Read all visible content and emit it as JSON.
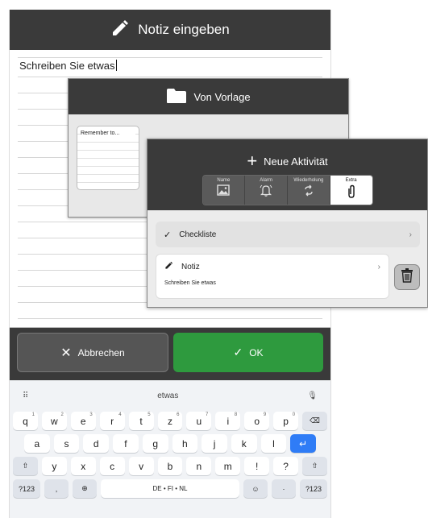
{
  "note_screen": {
    "title": "Notiz eingeben",
    "text": "Schreiben Sie etwas",
    "cancel_label": "Abbrechen",
    "ok_label": "OK",
    "colors": {
      "header": "#3a3a3a",
      "ok": "#2e9a3e",
      "cancel": "#555555"
    }
  },
  "keyboard": {
    "suggestion": "etwas",
    "rows": [
      [
        {
          "k": "q",
          "s": "1"
        },
        {
          "k": "w",
          "s": "2"
        },
        {
          "k": "e",
          "s": "3"
        },
        {
          "k": "r",
          "s": "4"
        },
        {
          "k": "t",
          "s": "5"
        },
        {
          "k": "z",
          "s": "6"
        },
        {
          "k": "u",
          "s": "7"
        },
        {
          "k": "i",
          "s": "8"
        },
        {
          "k": "o",
          "s": "9"
        },
        {
          "k": "p",
          "s": "0"
        },
        {
          "k": "⌫",
          "fn": true
        }
      ],
      [
        {
          "k": "a"
        },
        {
          "k": "s"
        },
        {
          "k": "d"
        },
        {
          "k": "f"
        },
        {
          "k": "g"
        },
        {
          "k": "h"
        },
        {
          "k": "j"
        },
        {
          "k": "k"
        },
        {
          "k": "l"
        },
        {
          "k": "↵",
          "enter": true
        }
      ],
      [
        {
          "k": "⇧",
          "fn": true
        },
        {
          "k": "y"
        },
        {
          "k": "x"
        },
        {
          "k": "c"
        },
        {
          "k": "v"
        },
        {
          "k": "b"
        },
        {
          "k": "n"
        },
        {
          "k": "m"
        },
        {
          "k": "!"
        },
        {
          "k": "?"
        },
        {
          "k": "⇧",
          "fn": true
        }
      ],
      [
        {
          "k": "?123",
          "fn": true
        },
        {
          "k": ",",
          "fn": true
        },
        {
          "k": "⊕",
          "fn": true
        },
        {
          "k": "DE • FI • NL",
          "space": true
        },
        {
          "k": "☺",
          "fn": true
        },
        {
          "k": "·",
          "fn": true
        },
        {
          "k": "?123",
          "fn": true
        }
      ]
    ]
  },
  "template_dialog": {
    "title": "Von Vorlage",
    "card_text": "Remember to..."
  },
  "activity_dialog": {
    "title": "Neue Aktivität",
    "tabs": [
      {
        "label": "Name",
        "icon": "image-icon"
      },
      {
        "label": "Alarm",
        "icon": "bell-icon"
      },
      {
        "label": "Wiederholung",
        "icon": "repeat-icon"
      },
      {
        "label": "Extra",
        "icon": "paperclip-icon",
        "active": true
      }
    ],
    "checklist_label": "Checkliste",
    "note_label": "Notiz",
    "note_preview": "Schreiben Sie etwas"
  }
}
